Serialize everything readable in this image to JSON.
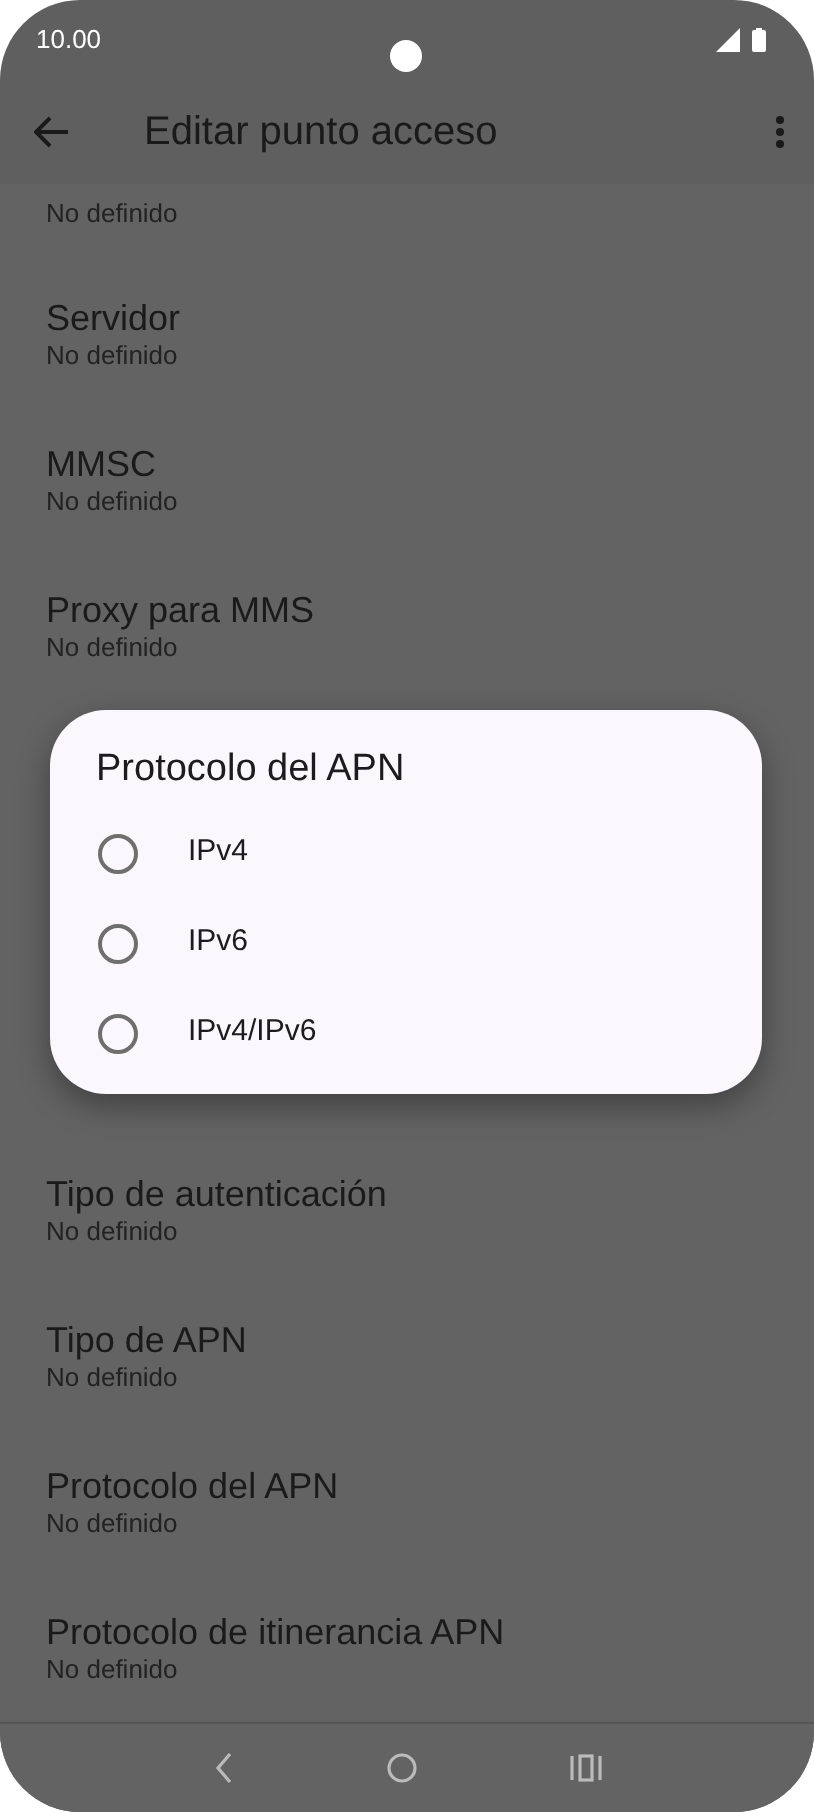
{
  "status_bar": {
    "time": "10.00"
  },
  "app_bar": {
    "title": "Editar punto acceso"
  },
  "list": {
    "top_subtitle": "No definido",
    "items_above": [
      {
        "title": "Servidor",
        "subtitle": "No definido"
      },
      {
        "title": "MMSC",
        "subtitle": "No definido"
      },
      {
        "title": "Proxy para MMS",
        "subtitle": "No definido"
      }
    ],
    "items_below": [
      {
        "title": "Tipo de autenticación",
        "subtitle": "No definido"
      },
      {
        "title": "Tipo de APN",
        "subtitle": "No definido"
      },
      {
        "title": "Protocolo del APN",
        "subtitle": "No definido"
      },
      {
        "title": "Protocolo de itinerancia APN",
        "subtitle": "No definido"
      }
    ]
  },
  "dialog": {
    "title": "Protocolo del APN",
    "options": [
      {
        "label": "IPv4",
        "selected": false
      },
      {
        "label": "IPv6",
        "selected": false
      },
      {
        "label": "IPv4/IPv6",
        "selected": false
      }
    ]
  }
}
